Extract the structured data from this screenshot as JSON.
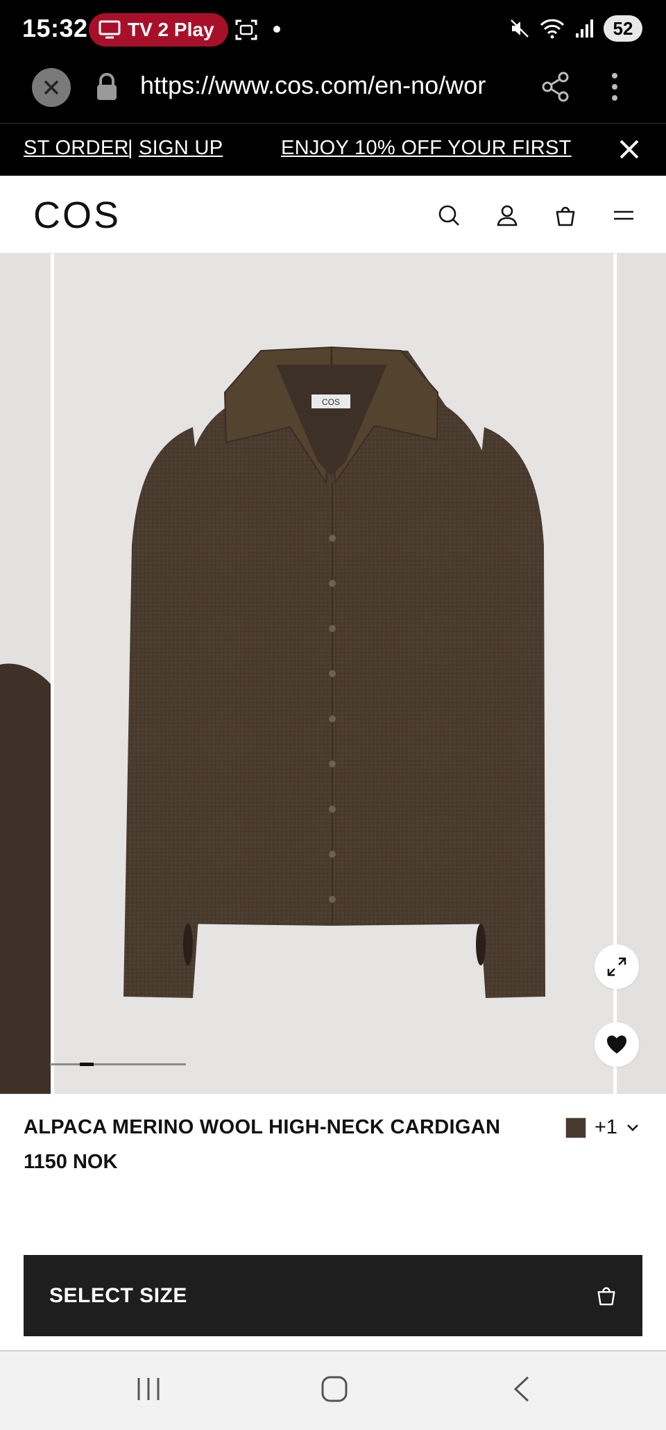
{
  "status_bar": {
    "time": "15:32",
    "tv_label": "TV 2 Play",
    "battery": "52",
    "icons": [
      "tv-icon",
      "screenshot-icon",
      "mute-icon",
      "wifi-icon",
      "signal-icon"
    ]
  },
  "browser": {
    "url": "https://www.cos.com/en-no/wor",
    "icons": [
      "close-icon",
      "lock-icon",
      "share-icon",
      "more-vert-icon"
    ]
  },
  "promo": {
    "fragment_a": "ST ORDER",
    "separator": "|",
    "fragment_b": "SIGN UP",
    "fragment_c": "ENJOY 10% OFF YOUR FIRST"
  },
  "header": {
    "logo": "COS",
    "icons": [
      "search-icon",
      "account-icon",
      "bag-icon",
      "menu-icon"
    ]
  },
  "gallery": {
    "product_label_tag": "COS",
    "icons": [
      "expand-icon",
      "heart-icon"
    ],
    "progress_fraction": 0.1,
    "progress_position": 0.22
  },
  "product": {
    "name": "ALPACA MERINO WOOL HIGH-NECK CARDIGAN",
    "price": "1150 NOK",
    "swatch_color": "#4a3a2d",
    "extra_colors": "+1"
  },
  "cta": {
    "select_size": "SELECT SIZE"
  },
  "colors": {
    "tv_pill": "#a8102a",
    "cta_bg": "#1e1e1e",
    "sweater": "#4a3b2f"
  }
}
